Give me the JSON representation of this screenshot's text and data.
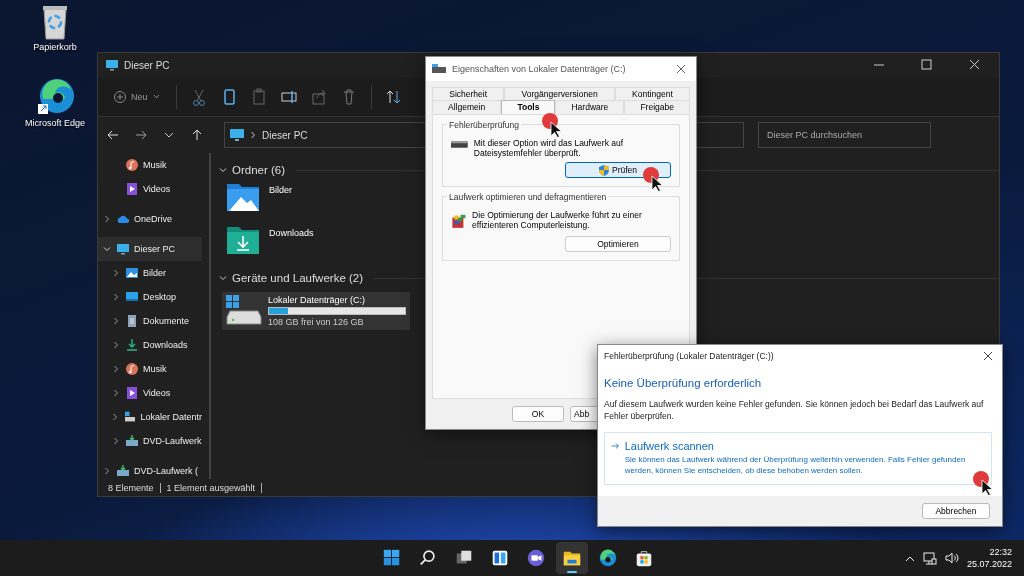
{
  "desktop_icons": [
    {
      "label": "Papierkorb",
      "kind": "bin"
    },
    {
      "label": "Microsoft Edge",
      "kind": "edge"
    }
  ],
  "explorer": {
    "title": "Dieser PC",
    "new_label": "Neu",
    "address": "Dieser PC",
    "search": {
      "placeholder": "Dieser PC durchsuchen"
    },
    "sidebar": {
      "pinned": [
        {
          "label": "Musik",
          "kind": "music"
        },
        {
          "label": "Videos",
          "kind": "video"
        }
      ],
      "tree": [
        {
          "label": "OneDrive",
          "kind": "cloud",
          "expanded": false,
          "selected": false
        },
        {
          "label": "Dieser PC",
          "kind": "pc",
          "expanded": true,
          "selected": true,
          "children": [
            {
              "label": "Bilder",
              "kind": "pictures",
              "expanded": false,
              "selected": false
            },
            {
              "label": "Desktop",
              "kind": "desktop",
              "expanded": false,
              "selected": false
            },
            {
              "label": "Dokumente",
              "kind": "documents",
              "expanded": false,
              "selected": false
            },
            {
              "label": "Downloads",
              "kind": "download",
              "expanded": false,
              "selected": false
            },
            {
              "label": "Musik",
              "kind": "music",
              "expanded": false,
              "selected": false
            },
            {
              "label": "Videos",
              "kind": "video",
              "expanded": false,
              "selected": false
            },
            {
              "label": "Lokaler Datentr",
              "kind": "drive",
              "expanded": false,
              "selected": false
            },
            {
              "label": "DVD-Laufwerk",
              "kind": "dvd",
              "expanded": false,
              "selected": false
            }
          ]
        },
        {
          "label": "DVD-Laufwerk (",
          "kind": "dvd",
          "expanded": false,
          "selected": false
        }
      ]
    },
    "groups": [
      {
        "title": "Ordner (6)",
        "kind": "folders",
        "expanded": true,
        "items": [
          {
            "label": "Bilder",
            "kind": "pictures"
          },
          {
            "label": "Downloads",
            "kind": "download"
          }
        ]
      },
      {
        "title": "Geräte und Laufwerke (2)",
        "kind": "drives",
        "expanded": true,
        "items": [
          {
            "label": "Lokaler Datenträger (C:)",
            "kind": "drive",
            "level": 0.14,
            "free": "108 GB frei von 126 GB",
            "selected": true
          }
        ]
      }
    ],
    "status_bar": [
      "8 Elemente",
      "1 Element ausgewählt"
    ]
  },
  "properties_dialog": {
    "title": "Eigenschaften von Lokaler Datenträger (C:)",
    "tab_rows": [
      [
        {
          "label": "Sicherheit",
          "selected": false
        },
        {
          "label": "Vorgängerversionen",
          "selected": false
        },
        {
          "label": "Kontingent",
          "selected": false
        }
      ],
      [
        {
          "label": "Allgemein",
          "selected": false
        },
        {
          "label": "Tools",
          "selected": true
        },
        {
          "label": "Hardware",
          "selected": false
        },
        {
          "label": "Freigabe",
          "selected": false
        }
      ]
    ],
    "sections": [
      {
        "title": "Fehlerüberprüfung",
        "kind": "check",
        "text": "Mit dieser Option wird das Laufwerk auf Dateisystemfehler überprüft.",
        "button": "Prüfen",
        "shield": true
      },
      {
        "title": "Laufwerk optimieren und defragmentieren",
        "kind": "defrag",
        "text": "Die Optimierung der Laufwerke führt zu einer effizienteren Computerleistung.",
        "button": "Optimieren",
        "shield": false
      }
    ],
    "buttons": [
      "OK",
      "Abb"
    ]
  },
  "check_dialog": {
    "title": "Fehlerüberprüfung (Lokaler Datenträger (C:))",
    "heading": "Keine Überprüfung erforderlich",
    "message": "Auf diesem Laufwerk wurden keine Fehler gefunden. Sie können jedoch bei Bedarf das Laufwerk auf Fehler überprüfen.",
    "command": {
      "title": "Laufwerk scannen",
      "description": "Sie können das Laufwerk während der Überprüfung weiterhin verwenden. Falls Fehler gefunden werden, können Sie entscheiden, ob diese behoben werden sollen."
    },
    "cancel": "Abbrechen"
  },
  "taskbar": {
    "apps": [
      {
        "kind": "start",
        "active": false
      },
      {
        "kind": "search",
        "active": false
      },
      {
        "kind": "taskview",
        "active": false
      },
      {
        "kind": "widgets",
        "active": false
      },
      {
        "kind": "chat",
        "active": false
      },
      {
        "kind": "explorer",
        "active": true
      },
      {
        "kind": "edge",
        "active": false
      },
      {
        "kind": "store",
        "active": false
      }
    ],
    "time": "22:32",
    "date": "25.07.2022"
  }
}
